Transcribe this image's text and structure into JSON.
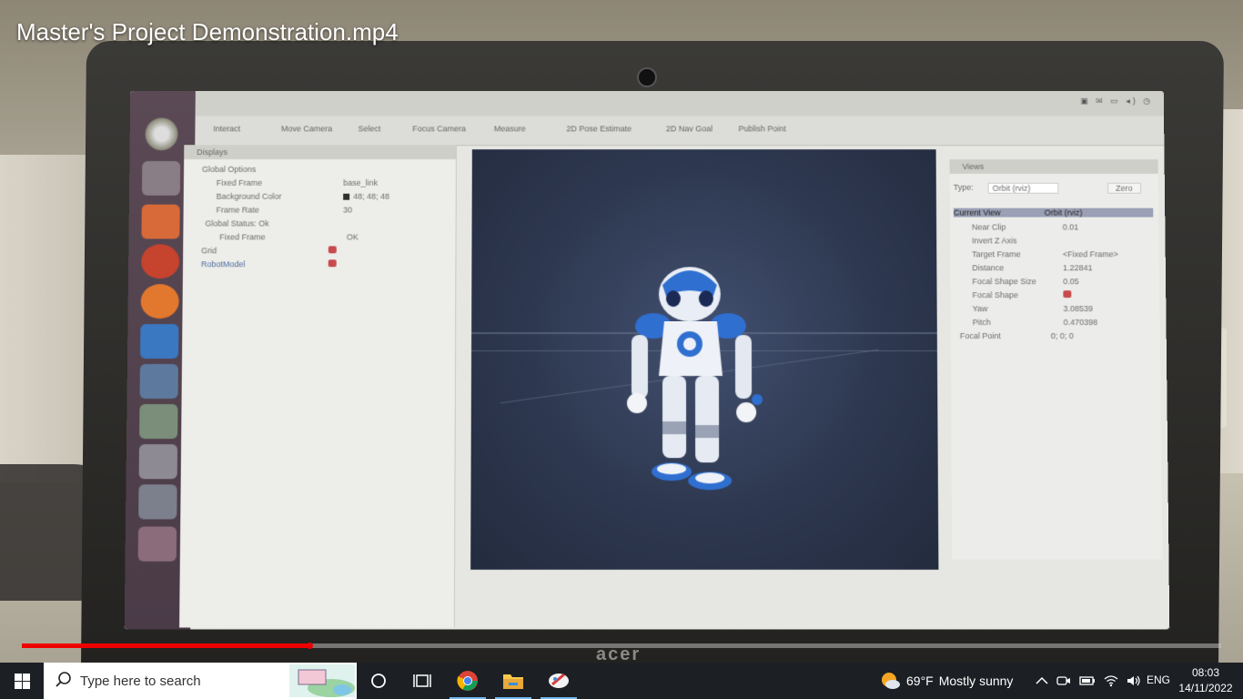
{
  "video": {
    "title": "Master's Project Demonstration.mp4",
    "progress_fraction": 0.24
  },
  "rviz": {
    "toolbar_items": [
      "Interact",
      "Move Camera",
      "Select",
      "Focus Camera",
      "Measure",
      "2D Pose Estimate",
      "2D Nav Goal",
      "Publish Point"
    ],
    "displays_title": "Displays",
    "displays_rows": [
      {
        "label": "Global Options",
        "value": ""
      },
      {
        "label": "Fixed Frame",
        "value": "base_link"
      },
      {
        "label": "Background Color",
        "value": "48; 48; 48"
      },
      {
        "label": "Frame Rate",
        "value": "30"
      },
      {
        "label": "Global Status: Ok",
        "value": ""
      },
      {
        "label": "Fixed Frame",
        "value": "OK"
      },
      {
        "label": "Grid",
        "value": ""
      },
      {
        "label": "RobotModel",
        "value": ""
      }
    ],
    "views_title": "Views",
    "views_type_label": "Type:",
    "views_type_value": "Orbit (rviz)",
    "views_zero": "Zero",
    "views_rows": [
      {
        "label": "Current View",
        "value": "Orbit (rviz)"
      },
      {
        "label": "Near Clip",
        "value": "0.01"
      },
      {
        "label": "Invert Z Axis",
        "value": ""
      },
      {
        "label": "Target Frame",
        "value": "<Fixed Frame>"
      },
      {
        "label": "Distance",
        "value": "1.22841"
      },
      {
        "label": "Focal Shape Size",
        "value": "0.05"
      },
      {
        "label": "Focal Shape",
        "value": ""
      },
      {
        "label": "Yaw",
        "value": "3.08539"
      },
      {
        "label": "Pitch",
        "value": "0.470398"
      },
      {
        "label": "Focal Point",
        "value": "0; 0; 0"
      }
    ]
  },
  "taskbar": {
    "search_placeholder": "Type here to search",
    "weather_temp": "69°F",
    "weather_desc": "Mostly sunny",
    "language": "ENG",
    "time": "08:03",
    "date": "14/11/2022"
  },
  "colors": {
    "progress": "#ff0000",
    "taskbar": "#1c2024",
    "taskbar_active": "#76b9ed"
  },
  "icons": [
    "windows-start-icon",
    "search-icon",
    "task-view-icon",
    "multitasking-icon",
    "chrome-icon",
    "file-explorer-icon",
    "snip-sketch-icon",
    "weather-sun-icon",
    "show-hidden-icons-icon",
    "meet-now-icon",
    "battery-icon",
    "wifi-icon",
    "volume-icon"
  ]
}
